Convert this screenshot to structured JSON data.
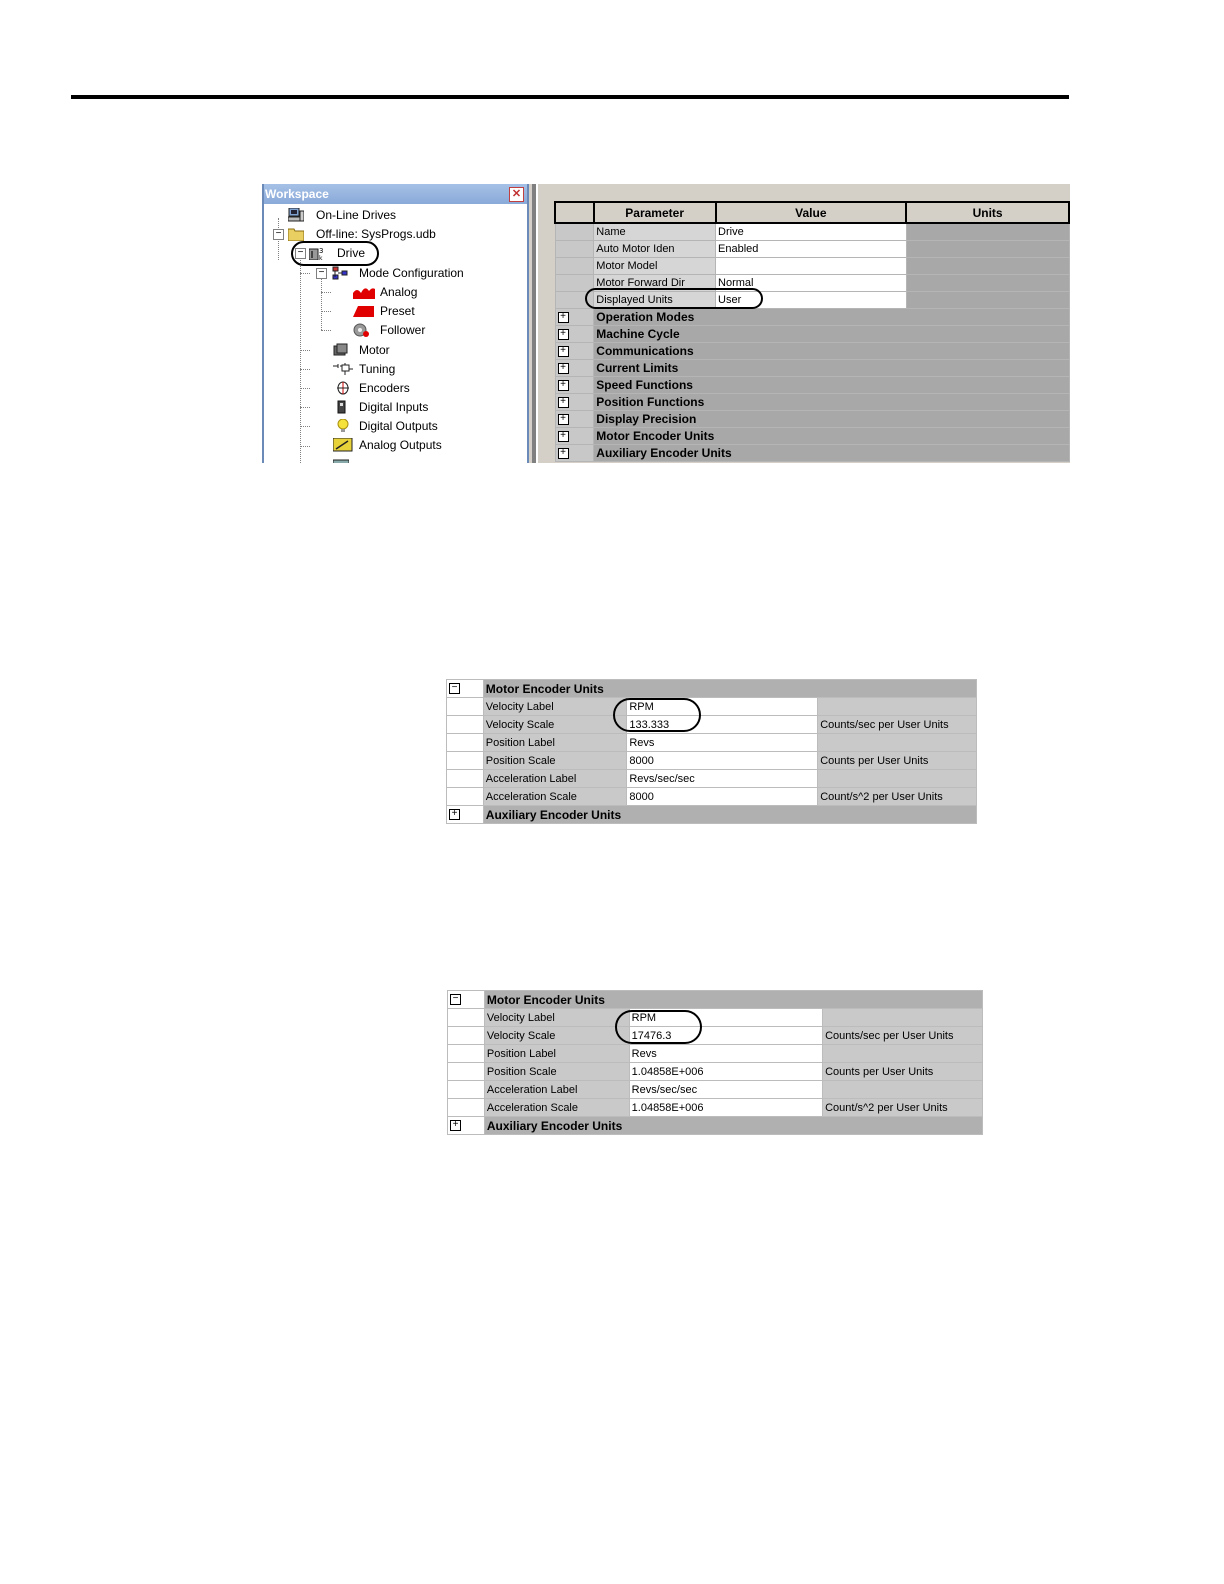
{
  "workspace": {
    "title": "Workspace",
    "close_glyph": "✕",
    "tree": {
      "online": "On-Line Drives",
      "offline": "Off-line: SysProgs.udb",
      "drive": "Drive",
      "mode_config": "Mode Configuration",
      "analog": "Analog",
      "preset": "Preset",
      "follower": "Follower",
      "motor": "Motor",
      "tuning": "Tuning",
      "encoders": "Encoders",
      "digital_inputs": "Digital Inputs",
      "digital_outputs": "Digital Outputs",
      "analog_outputs": "Analog Outputs"
    }
  },
  "param_grid": {
    "headers": [
      "Parameter",
      "Value",
      "Units"
    ],
    "rows": [
      {
        "param": "Name",
        "value": "Drive"
      },
      {
        "param": "Auto Motor Iden",
        "value": "Enabled"
      },
      {
        "param": "Motor Model",
        "value": ""
      },
      {
        "param": "Motor Forward Dir",
        "value": "Normal"
      },
      {
        "param": "Displayed Units",
        "value": "User"
      }
    ],
    "categories": [
      "Operation Modes",
      "Machine Cycle",
      "Communications",
      "Current Limits",
      "Speed Functions",
      "Position Functions",
      "Display Precision",
      "Motor Encoder Units",
      "Auxiliary Encoder Units"
    ]
  },
  "encoder_grid_1": {
    "section": "Motor Encoder Units",
    "rows": [
      {
        "param": "Velocity Label",
        "value": "RPM",
        "units": ""
      },
      {
        "param": "Velocity Scale",
        "value": "133.333",
        "units": "Counts/sec per User Units"
      },
      {
        "param": "Position Label",
        "value": "Revs",
        "units": ""
      },
      {
        "param": "Position Scale",
        "value": "8000",
        "units": "Counts per User Units"
      },
      {
        "param": "Acceleration Label",
        "value": "Revs/sec/sec",
        "units": ""
      },
      {
        "param": "Acceleration Scale",
        "value": "8000",
        "units": "Count/s^2 per User Units"
      }
    ],
    "next_section": "Auxiliary Encoder Units"
  },
  "encoder_grid_2": {
    "section": "Motor Encoder Units",
    "rows": [
      {
        "param": "Velocity Label",
        "value": "RPM",
        "units": ""
      },
      {
        "param": "Velocity Scale",
        "value": "17476.3",
        "units": "Counts/sec per User Units"
      },
      {
        "param": "Position Label",
        "value": "Revs",
        "units": ""
      },
      {
        "param": "Position Scale",
        "value": "1.04858E+006",
        "units": "Counts per User Units"
      },
      {
        "param": "Acceleration Label",
        "value": "Revs/sec/sec",
        "units": ""
      },
      {
        "param": "Acceleration Scale",
        "value": "1.04858E+006",
        "units": "Count/s^2 per User Units"
      }
    ],
    "next_section": "Auxiliary Encoder Units"
  }
}
